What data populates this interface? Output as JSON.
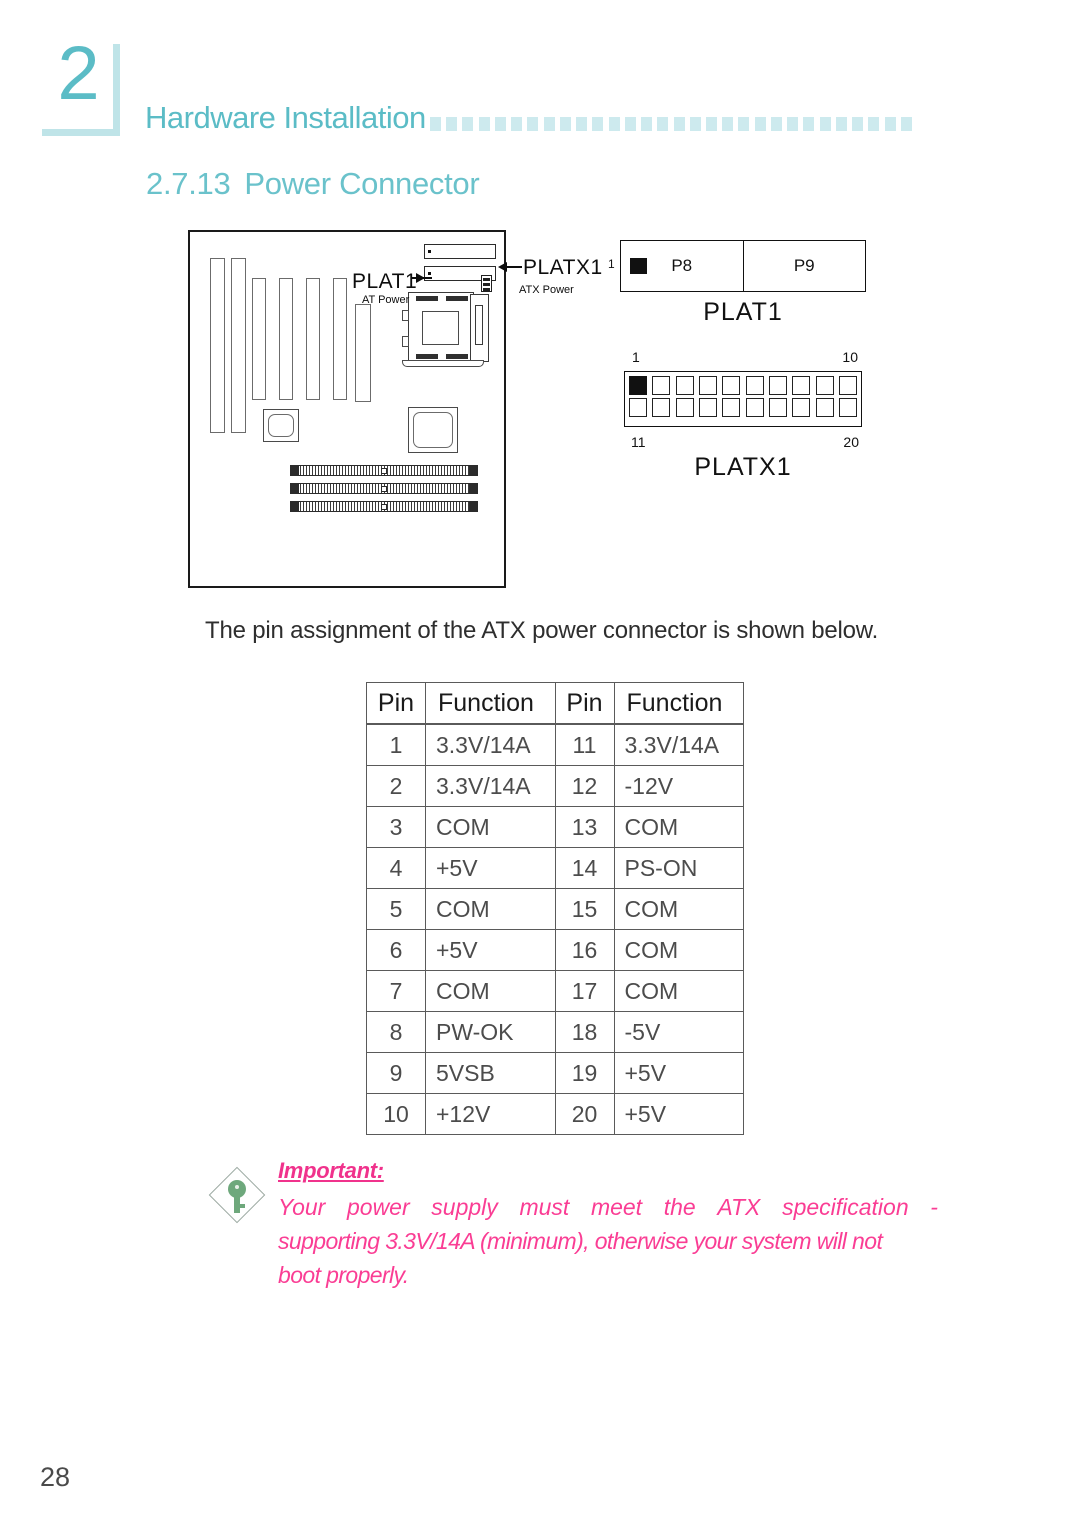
{
  "header": {
    "chapter_number": "2",
    "title": "Hardware Installation",
    "dot_count": 30,
    "accent_color": "#5bbcc6",
    "dot_color": "#cdeaee"
  },
  "section": {
    "number": "2.7.13",
    "title": "Power Connector"
  },
  "diagram": {
    "plat1_label": "PLAT1",
    "at_power_label": "AT Power",
    "platx1_label": "PLATX1",
    "atx_power_label": "ATX Power"
  },
  "plat1_connector": {
    "caption": "PLAT1",
    "pin1_label": "1",
    "segments": [
      "P8",
      "P9"
    ]
  },
  "platx1_connector": {
    "caption": "PLATX1",
    "top_left_label": "1",
    "top_right_label": "10",
    "bottom_left_label": "11",
    "bottom_right_label": "20",
    "pins_per_row": 10
  },
  "intro_text": "The pin assignment of the ATX power connector is shown below.",
  "pin_table": {
    "headers": [
      "Pin",
      "Function",
      "Pin",
      "Function"
    ],
    "rows": [
      [
        "1",
        "3.3V/14A",
        "11",
        "3.3V/14A"
      ],
      [
        "2",
        "3.3V/14A",
        "12",
        "-12V"
      ],
      [
        "3",
        "COM",
        "13",
        "COM"
      ],
      [
        "4",
        "+5V",
        "14",
        "PS-ON"
      ],
      [
        "5",
        "COM",
        "15",
        "COM"
      ],
      [
        "6",
        "+5V",
        "16",
        "COM"
      ],
      [
        "7",
        "COM",
        "17",
        "COM"
      ],
      [
        "8",
        "PW-OK",
        "18",
        "-5V"
      ],
      [
        "9",
        "5VSB",
        "19",
        "+5V"
      ],
      [
        "10",
        "+12V",
        "20",
        "+5V"
      ]
    ]
  },
  "important": {
    "label": "Important:",
    "line1_words": [
      "Your",
      "power",
      "supply",
      "must",
      "meet",
      "the",
      "ATX",
      "specification",
      "-"
    ],
    "line2": "supporting 3.3V/14A (minimum), otherwise your system will not",
    "line3": "boot properly.",
    "text_color": "#fa3d94",
    "icon": "key-icon"
  },
  "footer": {
    "page_number": "28"
  }
}
